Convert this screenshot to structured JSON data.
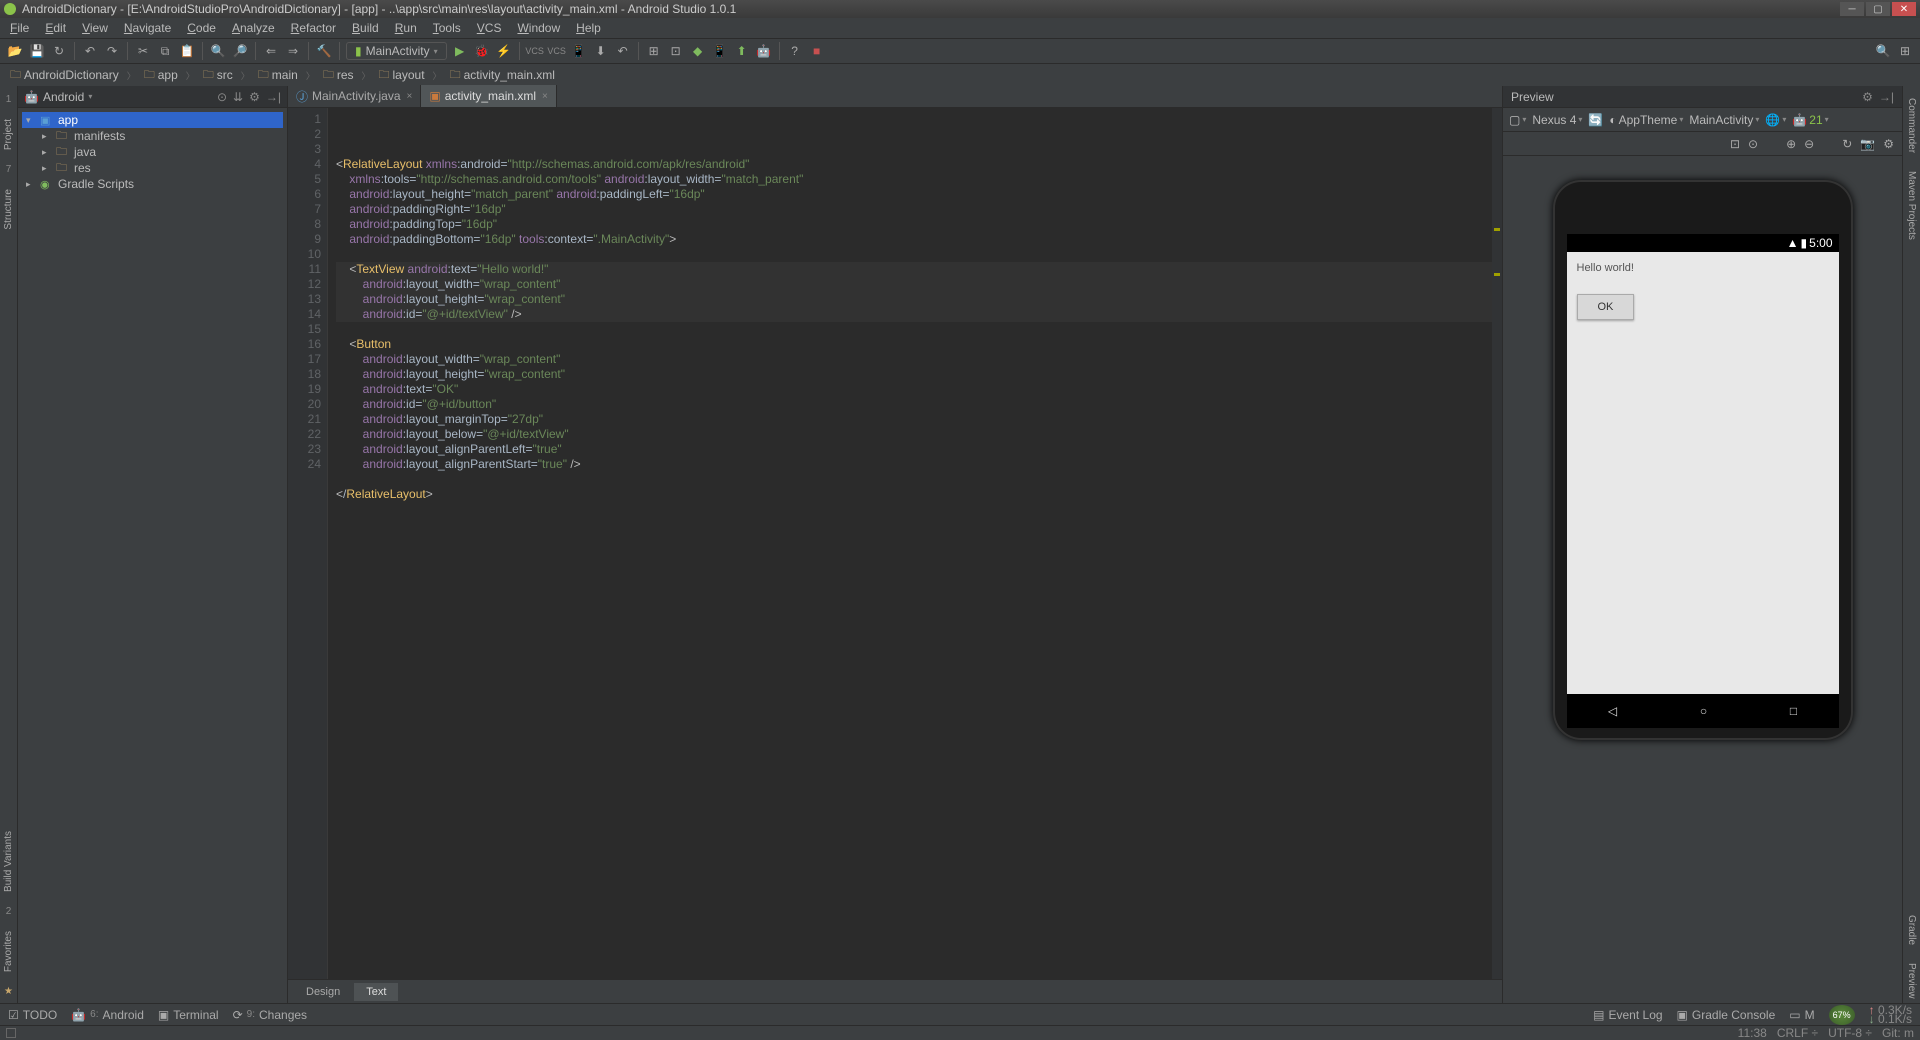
{
  "title": "AndroidDictionary - [E:\\AndroidStudioPro\\AndroidDictionary] - [app] - ..\\app\\src\\main\\res\\layout\\activity_main.xml - Android Studio 1.0.1",
  "menu": [
    "File",
    "Edit",
    "View",
    "Navigate",
    "Code",
    "Analyze",
    "Refactor",
    "Build",
    "Run",
    "Tools",
    "VCS",
    "Window",
    "Help"
  ],
  "toolbar": {
    "run_config": "MainActivity"
  },
  "breadcrumb": [
    "AndroidDictionary",
    "app",
    "src",
    "main",
    "res",
    "layout",
    "activity_main.xml"
  ],
  "project": {
    "view_label": "Android",
    "root": "app",
    "children": [
      "manifests",
      "java",
      "res"
    ],
    "scripts": "Gradle Scripts"
  },
  "editor": {
    "tabs": [
      {
        "label": "MainActivity.java",
        "type": "java",
        "active": false
      },
      {
        "label": "activity_main.xml",
        "type": "xml",
        "active": true
      }
    ],
    "line_count": 24,
    "design_tab": "Design",
    "text_tab": "Text",
    "code_lines": [
      "<RelativeLayout xmlns:android=\"http://schemas.android.com/apk/res/android\"",
      "    xmlns:tools=\"http://schemas.android.com/tools\" android:layout_width=\"match_parent\"",
      "    android:layout_height=\"match_parent\" android:paddingLeft=\"16dp\"",
      "    android:paddingRight=\"16dp\"",
      "    android:paddingTop=\"16dp\"",
      "    android:paddingBottom=\"16dp\" tools:context=\".MainActivity\">",
      "",
      "    <TextView android:text=\"Hello world!\"",
      "        android:layout_width=\"wrap_content\"",
      "        android:layout_height=\"wrap_content\"",
      "        android:id=\"@+id/textView\" />",
      "",
      "    <Button",
      "        android:layout_width=\"wrap_content\"",
      "        android:layout_height=\"wrap_content\"",
      "        android:text=\"OK\"",
      "        android:id=\"@+id/button\"",
      "        android:layout_marginTop=\"27dp\"",
      "        android:layout_below=\"@+id/textView\"",
      "        android:layout_alignParentLeft=\"true\"",
      "        android:layout_alignParentStart=\"true\" />",
      "",
      "</RelativeLayout>",
      ""
    ]
  },
  "preview": {
    "title": "Preview",
    "device": "Nexus 4",
    "theme": "AppTheme",
    "activity": "MainActivity",
    "api": "21",
    "status_time": "5:00",
    "hello_text": "Hello world!",
    "button_text": "OK"
  },
  "left_tools": [
    "Project",
    "Structure"
  ],
  "right_tools": [
    "Commander",
    "Maven Projects",
    "Gradle",
    "Preview"
  ],
  "bottom_tools": {
    "todo": "TODO",
    "android": "Android",
    "terminal": "Terminal",
    "changes": "Changes",
    "event_log": "Event Log",
    "gradle_console": "Gradle Console",
    "memory": "M"
  },
  "status": {
    "time": "11:38",
    "line_sep": "CRLF",
    "encoding": "UTF-8",
    "git": "Git: m",
    "mem": "67%",
    "net_up": "0.3K/s",
    "net_down": "0.1K/s"
  },
  "bottom_left_tools": [
    "Build Variants",
    "Favorites"
  ]
}
